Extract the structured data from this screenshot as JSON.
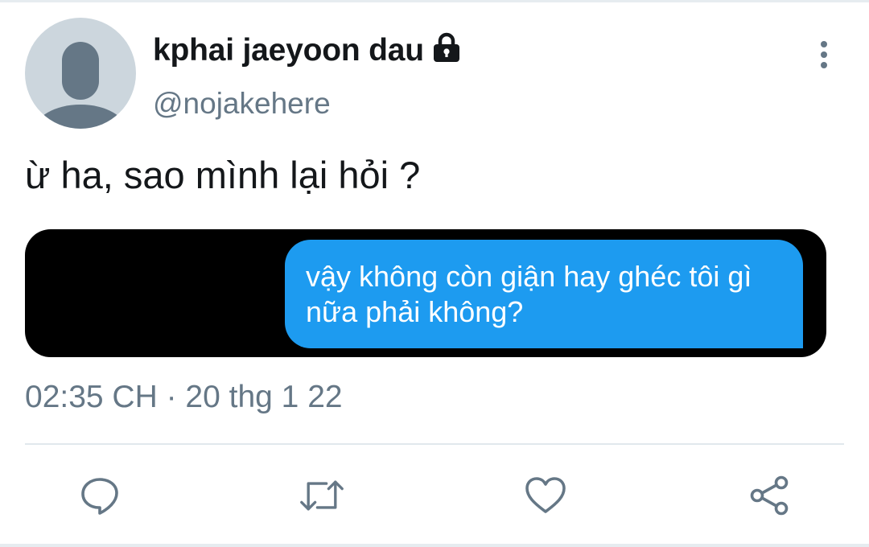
{
  "tweet": {
    "author": {
      "display_name": "kphai jaeyoon dau",
      "handle": "@nojakehere",
      "protected_icon": "lock-icon",
      "avatar": "default-avatar"
    },
    "text": "ừ ha, sao mình lại hỏi ?",
    "media": {
      "bubble_text": "vậy không còn giận hay ghéc tôi gì nữa phải không?"
    },
    "timestamp": "02:35 CH · 20 thg 1 22",
    "more_icon": "more-vertical-icon"
  },
  "actions": [
    {
      "name": "reply",
      "icon": "reply-icon"
    },
    {
      "name": "retweet",
      "icon": "retweet-icon"
    },
    {
      "name": "like",
      "icon": "heart-icon"
    },
    {
      "name": "share",
      "icon": "share-icon"
    }
  ],
  "colors": {
    "text": "#14171a",
    "secondary": "#657786",
    "icon": "#657786",
    "bubble": "#1d9bf0",
    "avatar_bg": "#ccd6dd",
    "avatar_fg": "#657786"
  }
}
